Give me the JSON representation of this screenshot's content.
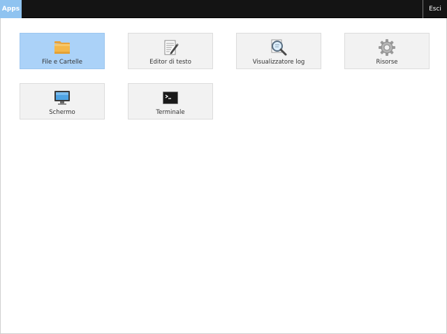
{
  "topbar": {
    "apps_label": "Apps",
    "exit_label": "Esci"
  },
  "apps": [
    {
      "label": "File e Cartelle",
      "icon": "folder-icon",
      "selected": true
    },
    {
      "label": "Editor di testo",
      "icon": "text-editor-icon",
      "selected": false
    },
    {
      "label": "Visualizzatore log",
      "icon": "magnifier-icon",
      "selected": false
    },
    {
      "label": "Risorse",
      "icon": "gear-icon",
      "selected": false
    },
    {
      "label": "Schermo",
      "icon": "monitor-icon",
      "selected": false
    },
    {
      "label": "Terminale",
      "icon": "terminal-icon",
      "selected": false
    }
  ],
  "colors": {
    "accent": "#8fc3f0",
    "selected_tile": "#abd2f8",
    "topbar": "#141414",
    "tile": "#f2f2f2"
  }
}
